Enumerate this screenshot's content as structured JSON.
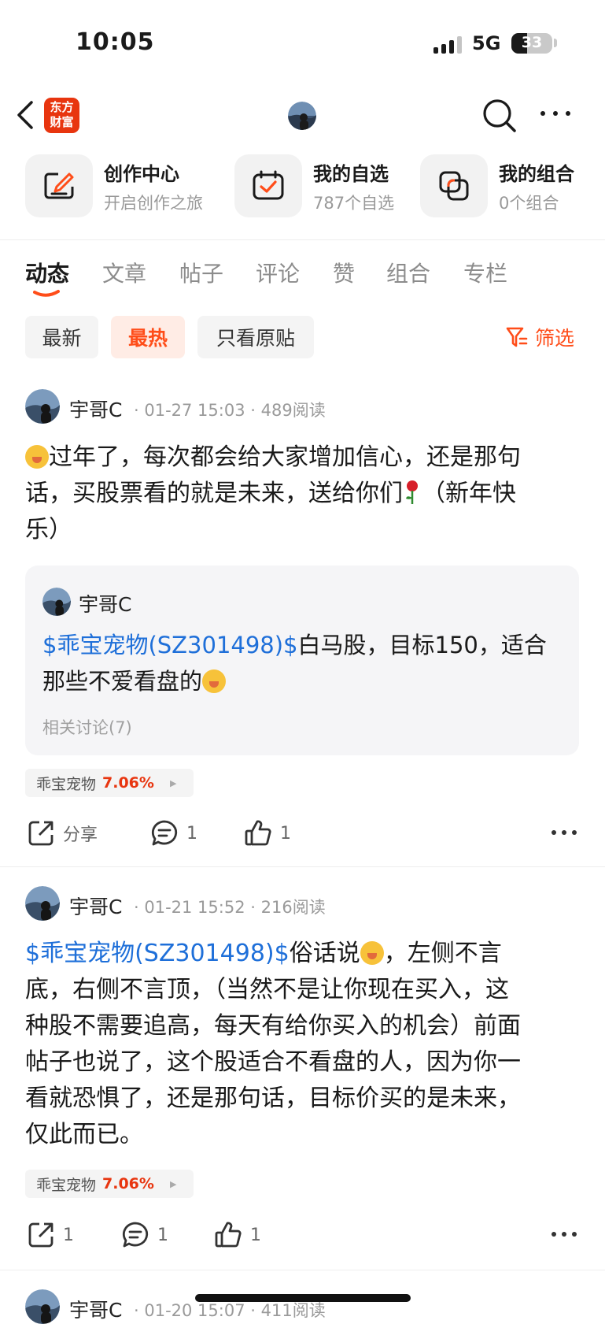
{
  "status_bar": {
    "time": "10:05",
    "network": "5G",
    "battery": "33"
  },
  "nav": {
    "logo_text": "东方\n财富"
  },
  "shortcuts": [
    {
      "title": "创作中心",
      "subtitle": "开启创作之旅",
      "icon": "edit-icon"
    },
    {
      "title": "我的自选",
      "subtitle": "787个自选",
      "icon": "check-icon"
    },
    {
      "title": "我的组合",
      "subtitle": "0个组合",
      "icon": "portfolio-icon"
    }
  ],
  "tabs": [
    "动态",
    "文章",
    "帖子",
    "评论",
    "赞",
    "组合",
    "专栏"
  ],
  "filters": {
    "newest": "最新",
    "hottest": "最热",
    "original_only": "只看原贴",
    "filter_label": "筛选"
  },
  "accent_color": "#ff4d19",
  "link_color": "#1e6fd9",
  "posts": [
    {
      "author": "宇哥C",
      "time": "01-27 15:03",
      "reads": "489阅读",
      "text_line1": "过年了，每次都会给大家增加信心，还是那句",
      "text_line2": "话，买股票看的就是未来，送给你们",
      "text_line2b": "（新年快",
      "text_line3": "乐）",
      "quote": {
        "author": "宇哥C",
        "stock_link": "$乖宝宠物(SZ301498)$",
        "text_a": "白马股，目标150，适合",
        "text_b": "那些不爱看盘的",
        "related": "相关讨论(7)"
      },
      "stock": {
        "name": "乖宝宠物",
        "change": "7.06%"
      },
      "actions": {
        "share": "分享",
        "comments": "1",
        "likes": "1"
      }
    },
    {
      "author": "宇哥C",
      "time": "01-21 15:52",
      "reads": "216阅读",
      "stock_link": "$乖宝宠物(SZ301498)$",
      "text_a": "俗话说",
      "text_b": "，左侧不言",
      "lines": [
        "底，右侧不言顶，（当然不是让你现在买入，这",
        "种股不需要追高，每天有给你买入的机会）前面",
        "帖子也说了，这个股适合不看盘的人，因为你一",
        "看就恐惧了，还是那句话，目标价买的是未来，",
        "仅此而已。"
      ],
      "stock": {
        "name": "乖宝宠物",
        "change": "7.06%"
      },
      "actions": {
        "shares": "1",
        "comments": "1",
        "likes": "1"
      }
    },
    {
      "author": "宇哥C",
      "time": "01-20 15:07",
      "reads": "411阅读"
    }
  ]
}
